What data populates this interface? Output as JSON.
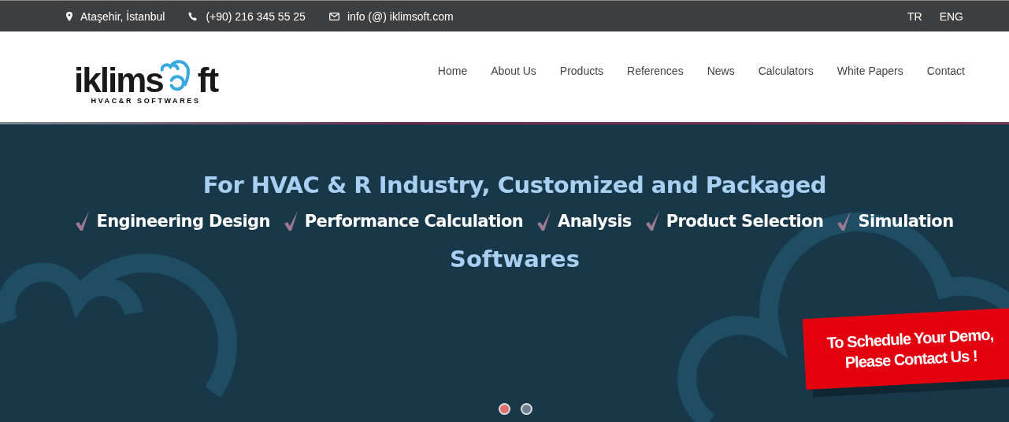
{
  "top_bar": {
    "contacts": [
      {
        "kind": "location",
        "text": "Ataşehir, İstanbul"
      },
      {
        "kind": "phone",
        "text": "(+90) 216 345 55 25"
      },
      {
        "kind": "email",
        "text": "info (@) iklimsoft.com"
      }
    ],
    "languages": [
      "TR",
      "ENG"
    ]
  },
  "logo": {
    "word_start": "iklims",
    "word_end": "ft",
    "tagline": "HVAC&R SOFTWARES"
  },
  "nav": [
    "Home",
    "About Us",
    "Products",
    "References",
    "News",
    "Calculators",
    "White Papers",
    "Contact"
  ],
  "hero": {
    "headline": "For HVAC & R Industry, Customized and Packaged",
    "features": [
      "Engineering Design",
      "Performance Calculation",
      "Analysis",
      "Product Selection",
      "Simulation"
    ],
    "subline": "Softwares",
    "ribbon": [
      "To Schedule Your Demo,",
      "Please Contact Us !"
    ],
    "dots": [
      {
        "selected": true
      },
      {
        "selected": false
      }
    ]
  }
}
